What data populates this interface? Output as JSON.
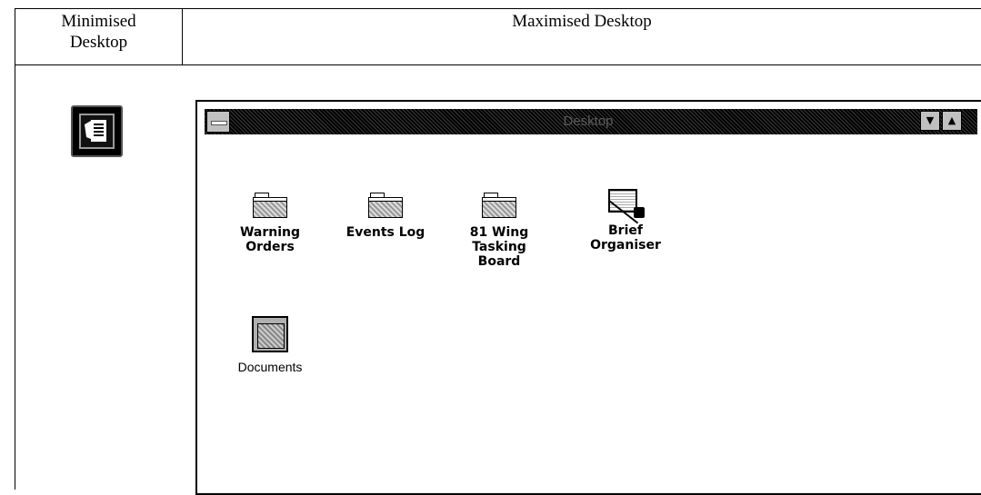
{
  "table": {
    "left_header": [
      "Minimised",
      "Desktop"
    ],
    "right_header": "Maximised Desktop"
  },
  "window": {
    "title": "Desktop"
  },
  "icons": [
    {
      "lines": [
        "Warning",
        "Orders"
      ],
      "icon": "folder-icon"
    },
    {
      "lines": [
        "Events Log"
      ],
      "icon": "folder-icon"
    },
    {
      "lines": [
        "81 Wing",
        "Tasking",
        "Board"
      ],
      "icon": "folder-icon"
    },
    {
      "lines": [
        "Brief",
        "Organiser"
      ],
      "icon": "brief-organiser-icon"
    },
    {
      "lines": [
        "Documents"
      ],
      "icon": "documents-icon"
    }
  ]
}
